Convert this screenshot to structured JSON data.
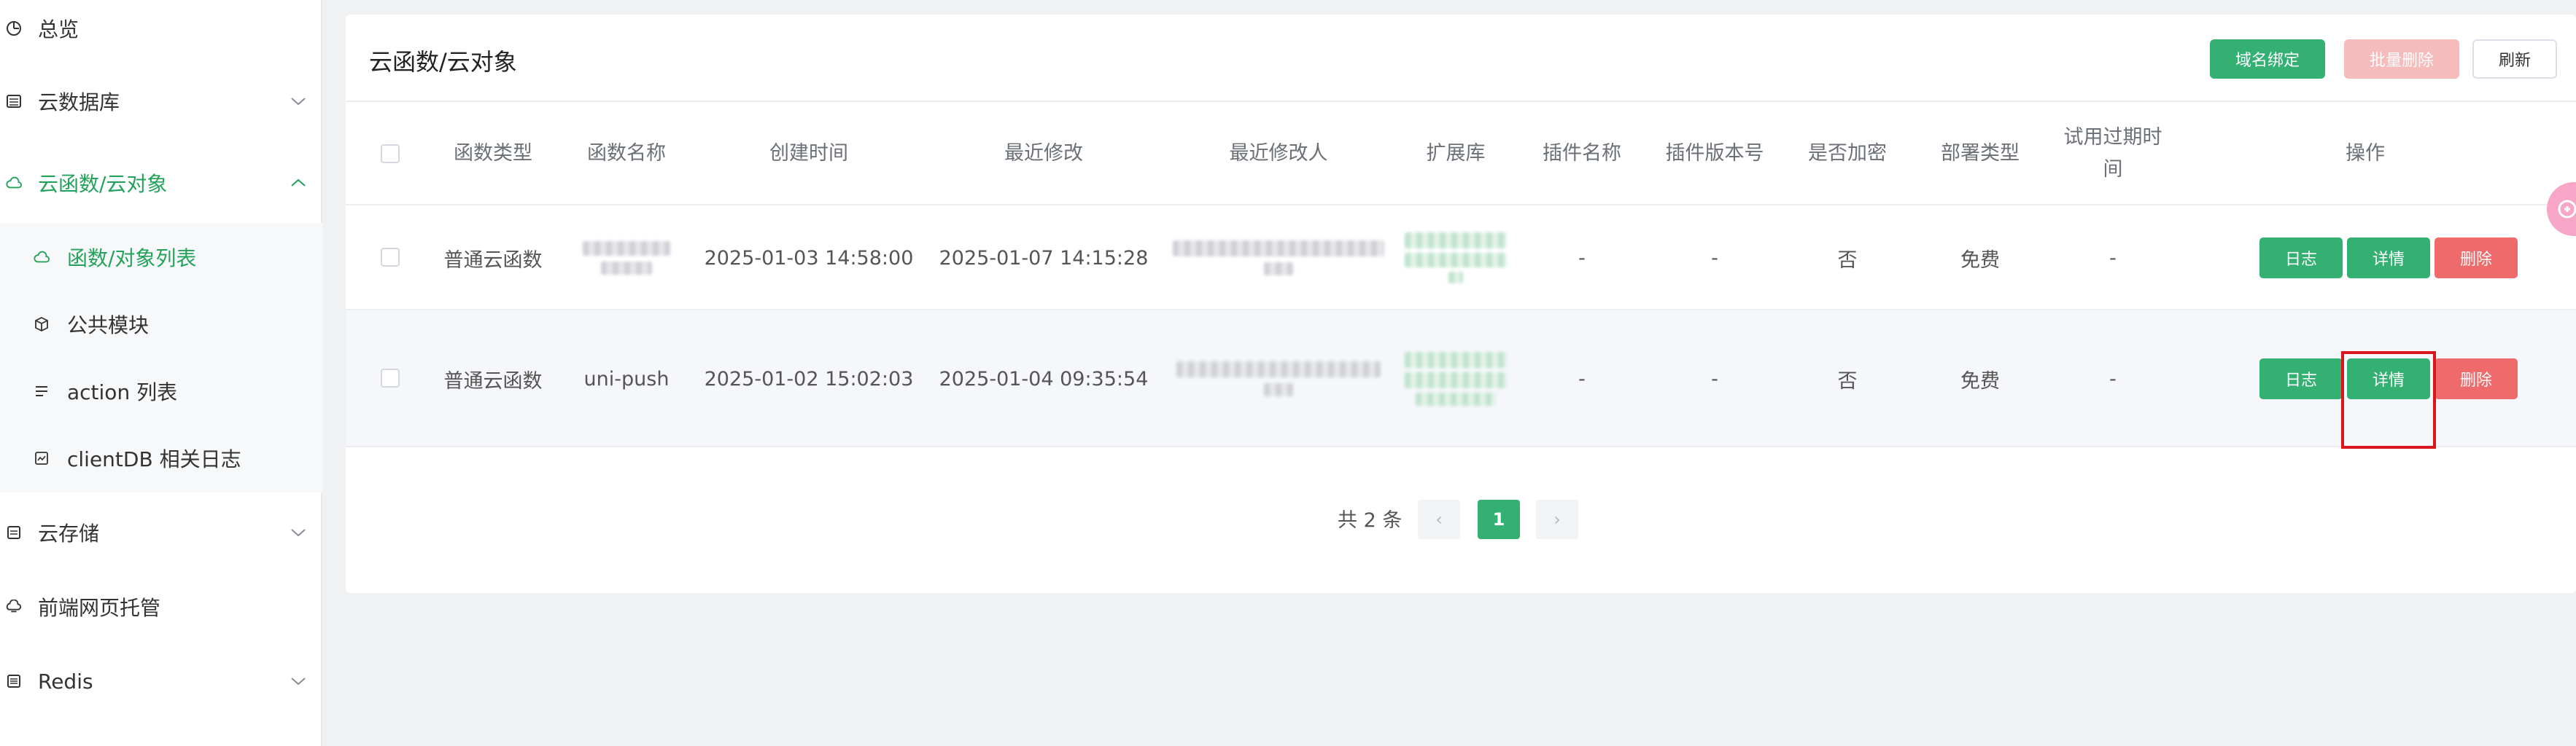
{
  "sidebar": {
    "items": [
      {
        "label": "总览",
        "icon": "dashboard-icon",
        "expandable": false
      },
      {
        "label": "云数据库",
        "icon": "database-icon",
        "expandable": true
      },
      {
        "label": "云函数/云对象",
        "icon": "cloud-icon",
        "expandable": true,
        "expanded": true,
        "active": true
      },
      {
        "label": "云存储",
        "icon": "storage-icon",
        "expandable": true
      },
      {
        "label": "前端网页托管",
        "icon": "hosting-icon",
        "expandable": false
      },
      {
        "label": "Redis",
        "icon": "redis-icon",
        "expandable": true
      }
    ],
    "subitems": [
      {
        "label": "函数/对象列表",
        "icon": "cloud-icon",
        "active": true
      },
      {
        "label": "公共模块",
        "icon": "cube-icon"
      },
      {
        "label": "action 列表",
        "icon": "list-icon"
      },
      {
        "label": "clientDB 相关日志",
        "icon": "log-icon"
      }
    ]
  },
  "header": {
    "title": "云函数/云对象",
    "buttons": {
      "bind_domain": "域名绑定",
      "batch_delete": "批量删除",
      "refresh": "刷新"
    }
  },
  "table": {
    "columns": [
      "函数类型",
      "函数名称",
      "创建时间",
      "最近修改",
      "最近修改人",
      "扩展库",
      "插件名称",
      "插件版本号",
      "是否加密",
      "部署类型",
      "试用过期时间",
      "操作"
    ],
    "column_last_trial_line1": "试用过期时",
    "column_last_trial_line2": "间",
    "rows": [
      {
        "type": "普通云函数",
        "name": "",
        "created": "2025-01-03 14:58:00",
        "modified": "2025-01-07 14:15:28",
        "modifier": "",
        "ext": "",
        "plugin_name": "-",
        "plugin_version": "-",
        "encrypted": "否",
        "deploy": "免费",
        "trial_expire": "-"
      },
      {
        "type": "普通云函数",
        "name": "uni-push",
        "created": "2025-01-02 15:02:03",
        "modified": "2025-01-04 09:35:54",
        "modifier": "",
        "ext": "",
        "plugin_name": "-",
        "plugin_version": "-",
        "encrypted": "否",
        "deploy": "免费",
        "trial_expire": "-"
      }
    ],
    "actions": {
      "log": "日志",
      "detail": "详情",
      "delete": "删除"
    }
  },
  "pagination": {
    "total": "共 2 条",
    "current": "1",
    "prev": "‹",
    "next": "›"
  },
  "colors": {
    "accent": "#35b073",
    "danger": "#ef6a6a",
    "highlight": "#d9161c"
  }
}
